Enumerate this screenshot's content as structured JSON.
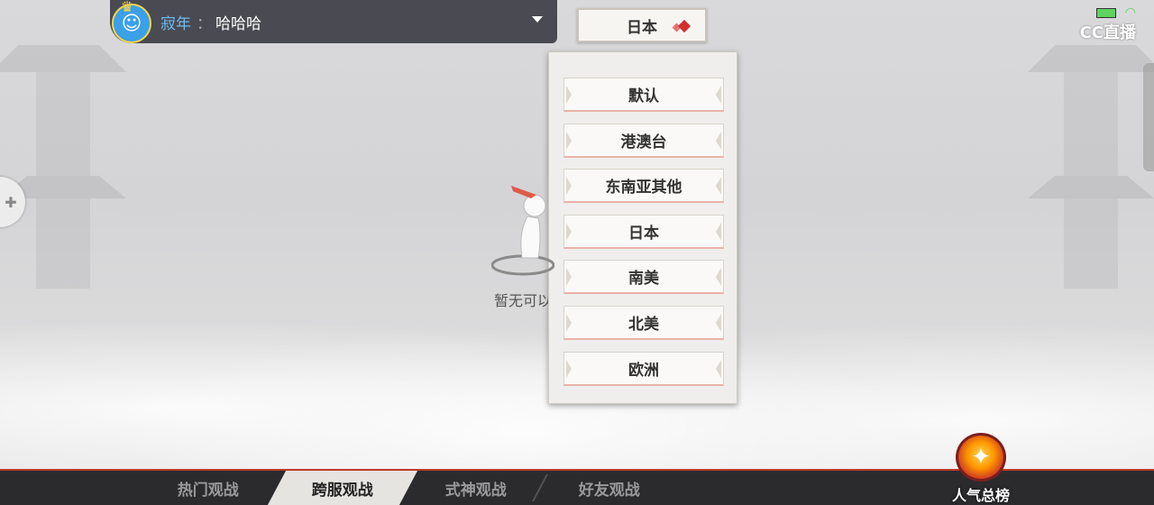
{
  "user_bar": {
    "avatar_icon": "crowned-blue-face-avatar",
    "name": "寂年",
    "separator": "：",
    "message": "哈哈哈"
  },
  "region_select": {
    "selected": "日本"
  },
  "region_options": [
    "默认",
    "港澳台",
    "东南亚其他",
    "日本",
    "南美",
    "北美",
    "欧洲"
  ],
  "empty_state": {
    "text": "暂无可以观战"
  },
  "status": {
    "cc_logo": "CC直播"
  },
  "tabs": [
    {
      "label": "热门观战",
      "active": false
    },
    {
      "label": "跨服观战",
      "active": true
    },
    {
      "label": "式神观战",
      "active": false
    },
    {
      "label": "好友观战",
      "active": false
    }
  ],
  "popularity": {
    "label": "人气总榜"
  },
  "colors": {
    "accent_red": "#c0392b",
    "tab_active_bg": "#e6e4e0",
    "user_name_blue": "#6fbaf2"
  }
}
